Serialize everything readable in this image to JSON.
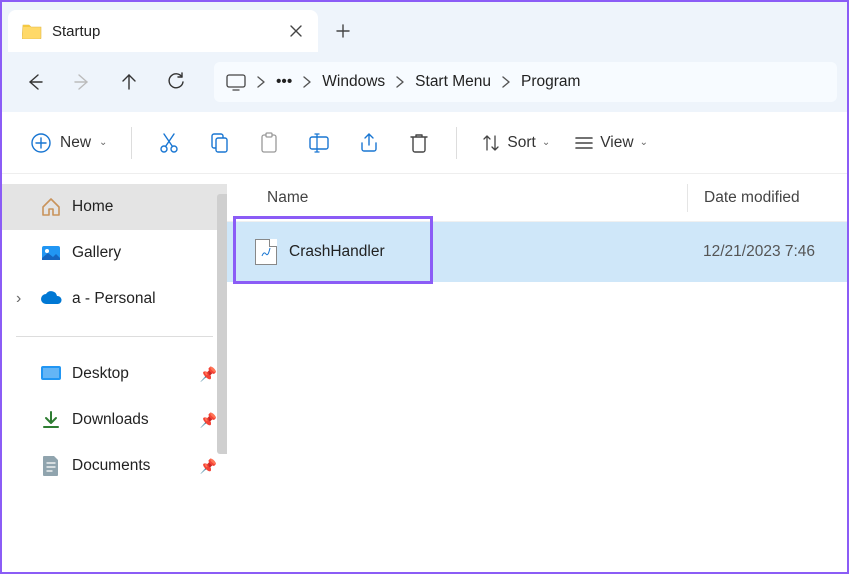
{
  "tab": {
    "title": "Startup"
  },
  "breadcrumb": {
    "items": [
      "Windows",
      "Start Menu",
      "Program"
    ]
  },
  "toolbar": {
    "new_label": "New",
    "sort_label": "Sort",
    "view_label": "View"
  },
  "sidebar": {
    "items": [
      {
        "label": "Home"
      },
      {
        "label": "Gallery"
      },
      {
        "label": "a - Personal"
      },
      {
        "label": "Desktop"
      },
      {
        "label": "Downloads"
      },
      {
        "label": "Documents"
      }
    ]
  },
  "headers": {
    "name": "Name",
    "date": "Date modified"
  },
  "files": [
    {
      "name": "CrashHandler",
      "date": "12/21/2023 7:46 "
    }
  ]
}
